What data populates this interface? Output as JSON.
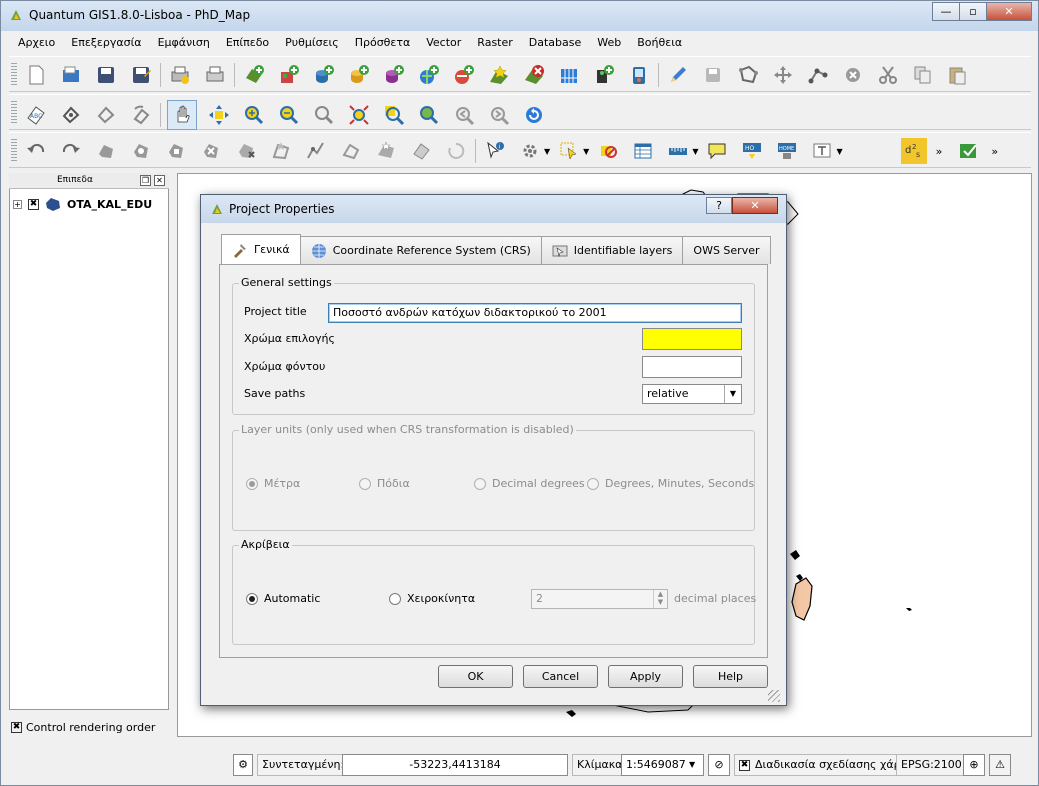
{
  "window": {
    "title": "Quantum GIS1.8.0-Lisboa - PhD_Map",
    "buttons": {
      "minimize": "—",
      "maximize": "▫",
      "close": "✕"
    }
  },
  "menubar": [
    "Αρχειο",
    "Επεξεργασία",
    "Εμφάνιση",
    "Επίπεδο",
    "Ρυθμίσεις",
    "Πρόσθετα",
    "Vector",
    "Raster",
    "Database",
    "Web",
    "Βοήθεια"
  ],
  "toolbars": {
    "row1": [
      "new-project-icon",
      "open-project-icon",
      "save-project-icon",
      "save-as-icon",
      "new-print-composer-icon",
      "print-composer-manager-icon",
      "add-vector-layer-icon",
      "add-raster-layer-icon",
      "add-postgis-layer-icon",
      "add-spatialite-layer-icon",
      "add-mssql-layer-icon",
      "add-wms-layer-icon",
      "add-wfs-layer-icon",
      "new-layer-icon",
      "remove-layer-icon",
      "add-wcs-layer-icon",
      "add-delimited-text-icon",
      "gps-icon",
      "toggle-editing-icon",
      "save-edits-icon",
      "add-feature-icon",
      "move-feature-icon",
      "node-tool-icon",
      "delete-selected-icon",
      "cut-features-icon",
      "copy-features-icon",
      "paste-features-icon"
    ],
    "row2": [
      "label-tool-icon",
      "pin-labels-icon",
      "show-labels-icon",
      "rotate-label-icon",
      "pan-icon",
      "pan-to-selection-icon",
      "zoom-in-icon",
      "zoom-out-icon",
      "zoom-actual-icon",
      "zoom-full-icon",
      "zoom-to-selection-icon",
      "zoom-to-layer-icon",
      "zoom-last-icon",
      "zoom-next-icon",
      "refresh-icon"
    ],
    "row3": [
      "undo-icon",
      "redo-icon",
      "simplify-icon",
      "add-ring-icon",
      "add-part-icon",
      "delete-ring-icon",
      "delete-part-icon",
      "reshape-icon",
      "offset-curve-icon",
      "split-icon",
      "merge-icon",
      "merge-attributes-icon",
      "rotate-symbols-icon",
      "identify-icon",
      "run-action-icon",
      "select-icon",
      "deselect-icon",
      "attribute-table-icon",
      "measure-icon",
      "map-tips-icon",
      "new-bookmark-icon",
      "show-bookmarks-icon",
      "text-annotation-icon",
      "d2s-icon",
      "plugin-icon"
    ]
  },
  "layers_panel": {
    "title": "Επιπεδα",
    "layer_name": "OTA_KAL_EDU",
    "render_order_label": "Control rendering order"
  },
  "dialog": {
    "title": "Project Properties",
    "tabs": [
      "Γενικά",
      "Coordinate Reference System (CRS)",
      "Identifiable layers",
      "OWS Server"
    ],
    "general_settings": {
      "group_title": "General settings",
      "project_title_label": "Project title",
      "project_title_value": "Ποσοστό ανδρών κατόχων διδακτορικού το 2001",
      "selection_color_label": "Χρώμα επιλογής",
      "selection_color": "#ffff00",
      "background_color_label": "Χρώμα φόντου",
      "background_color": "#ffffff",
      "save_paths_label": "Save paths",
      "save_paths_value": "relative"
    },
    "layer_units": {
      "group_title": "Layer units (only used when CRS transformation is disabled)",
      "options": [
        "Μέτρα",
        "Πόδια",
        "Decimal degrees",
        "Degrees, Minutes, Seconds"
      ],
      "selected": "Μέτρα"
    },
    "precision": {
      "group_title": "Ακρίβεια",
      "automatic_label": "Automatic",
      "manual_label": "Χειροκίνητα",
      "decimal_value": "2",
      "decimal_suffix": "decimal places"
    },
    "buttons": {
      "ok": "OK",
      "cancel": "Cancel",
      "apply": "Apply",
      "help": "Help"
    }
  },
  "statusbar": {
    "coord_label": "Συντεταγμένη:",
    "coord_value": "-53223,4413184",
    "scale_label": "Κλίμακα",
    "scale_value": "1:5469087",
    "render_label": "Διαδικασία σχεδίασης χάρτη",
    "epsg": "EPSG:2100"
  },
  "colors": {
    "accent": "#3c7fb1",
    "map_island_fill": "#f4c8a6"
  }
}
